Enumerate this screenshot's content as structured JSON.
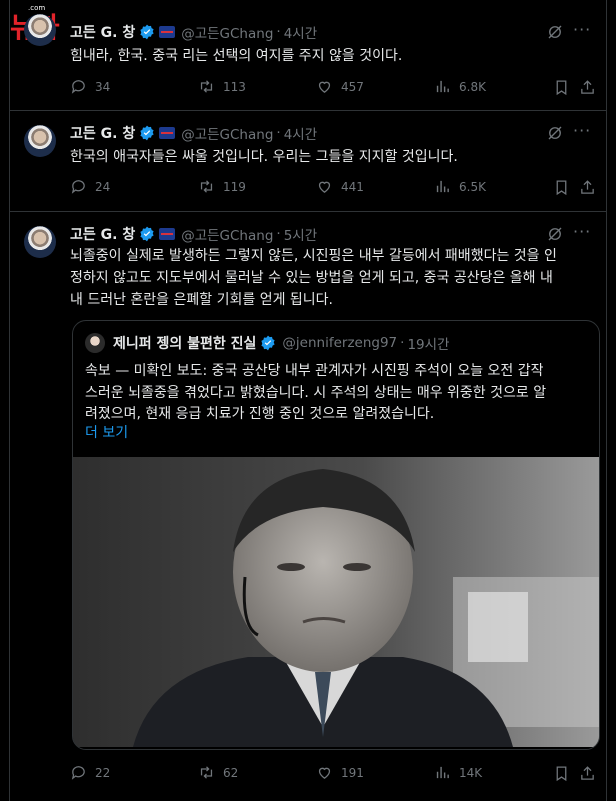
{
  "watermark": {
    "main": "뉴자",
    "sub": ".com"
  },
  "tweets": [
    {
      "name": "고든 G. 창",
      "handle": "@고든GChang",
      "time": "4시간",
      "text": "힘내라, 한국. 중국 리는 선택의 여지를 주지 않을 것이다.",
      "replies": "34",
      "reposts": "113",
      "likes": "457",
      "views": "6.8K"
    },
    {
      "name": "고든 G. 창",
      "handle": "@고든GChang",
      "time": "4시간",
      "text": "한국의 애국자들은 싸울 것입니다. 우리는 그들을 지지할 것입니다.",
      "replies": "24",
      "reposts": "119",
      "likes": "441",
      "views": "6.5K"
    },
    {
      "name": "고든 G. 창",
      "handle": "@고든GChang",
      "time": "5시간",
      "text_lines": [
        "뇌졸중이 실제로 발생하든 그렇지 않든, 시진핑은 내부 갈등에서 패배했다는 것을 인",
        "정하지 않고도 지도부에서 물러날 수 있는 방법을 얻게 되고, 중국 공산당은 올해 내",
        "내 드러난 혼란을 은폐할 기회를 얻게 됩니다."
      ],
      "replies": "22",
      "reposts": "62",
      "likes": "191",
      "views": "14K",
      "quote": {
        "name": "제니퍼 젱의 불편한 진실",
        "handle": "@jenniferzeng97",
        "time": "19시간",
        "text_lines": [
          "속보 — 미확인 보도: 중국 공산당 내부 관계자가 시진핑 주석이 오늘 오전 갑작",
          "스러운 뇌졸중을 겪었다고 밝혔습니다. 시 주석의 상태는 매우 위중한 것으로 알",
          "려졌으며, 현재 응급 치료가 진행 중인 것으로 알려졌습니다."
        ],
        "show_more": "더 보기"
      }
    }
  ],
  "colors": {
    "background": "#000000",
    "text": "#e7e9ea",
    "muted": "#71767b",
    "link": "#1d9bf0",
    "verified": "#1d9bf0"
  }
}
